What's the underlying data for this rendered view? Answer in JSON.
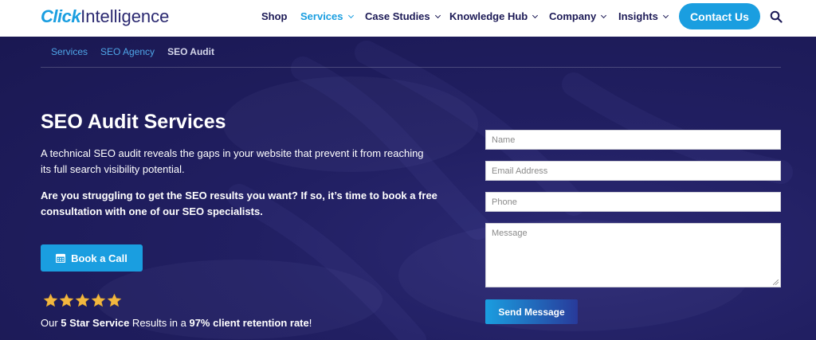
{
  "header": {
    "logo": {
      "part1": "Click",
      "part2": "Intelligence"
    },
    "menu": [
      {
        "label": "Shop",
        "dropdown": false
      },
      {
        "label": "Services",
        "dropdown": true,
        "active": true
      },
      {
        "label": "Case Studies",
        "dropdown": true
      },
      {
        "label": "Knowledge Hub",
        "dropdown": true
      },
      {
        "label": "Company",
        "dropdown": true
      },
      {
        "label": "Insights",
        "dropdown": true
      }
    ],
    "contact_label": "Contact Us",
    "search_icon": "search-icon"
  },
  "breadcrumb": {
    "items": [
      "Services",
      "SEO Agency"
    ],
    "current": "SEO Audit"
  },
  "hero": {
    "title": "SEO Audit Services",
    "intro": "A technical SEO audit reveals the gaps in your website that prevent it from reaching its full search visibility potential.",
    "question": "Are you struggling to get the SEO results you want? If so, it’s time to book a free consultation with one of our SEO specialists.",
    "book_label": "Book a Call",
    "book_icon": "calendar-icon",
    "rating": {
      "stars": 5,
      "text_before": "Our ",
      "highlight1": "5 Star Service",
      "text_middle": " Results in a ",
      "highlight2": "97% client retention rate",
      "text_after": "!"
    }
  },
  "form": {
    "name_placeholder": "Name",
    "email_placeholder": "Email Address",
    "phone_placeholder": "Phone",
    "message_placeholder": "Message",
    "submit_label": "Send Message"
  },
  "colors": {
    "brand_blue": "#1a9ee0",
    "navy": "#1c1a56",
    "star_gold": "#f2b740"
  }
}
